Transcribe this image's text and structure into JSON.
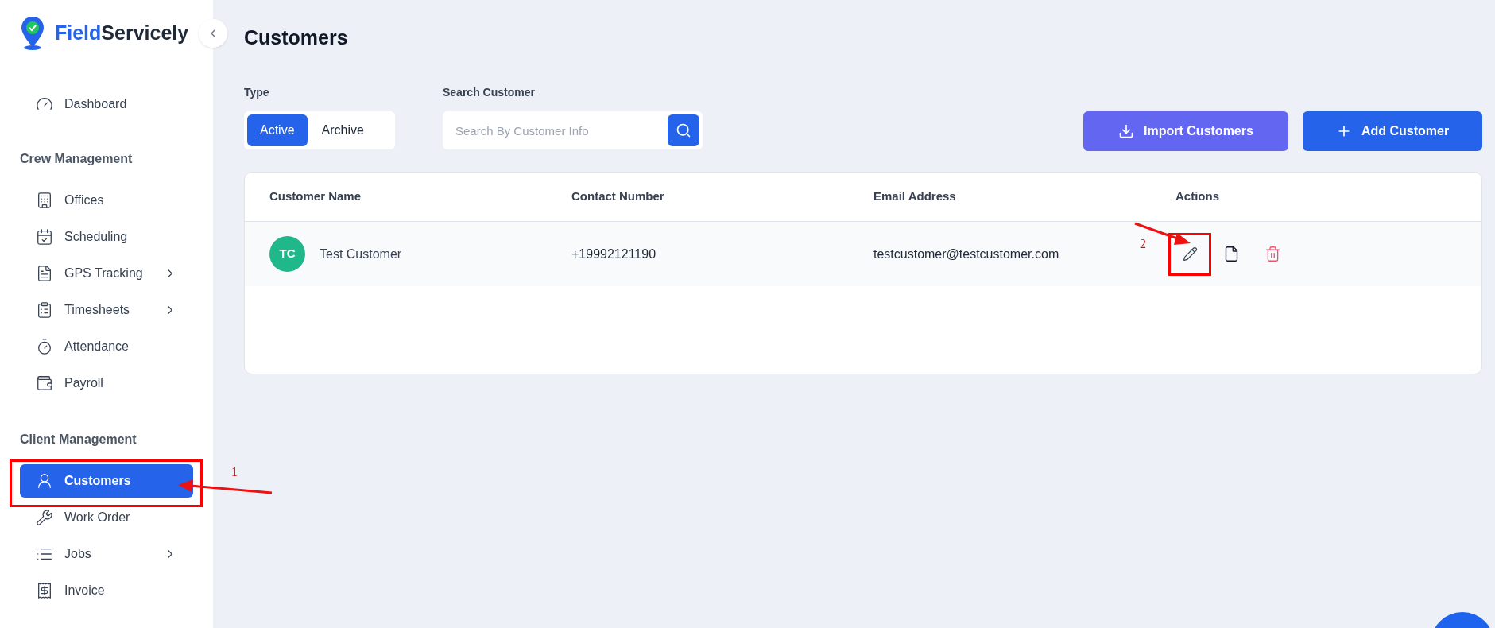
{
  "brand": {
    "first": "Field",
    "second": "Servicely"
  },
  "sidebar": {
    "sections": [
      {
        "items": [
          {
            "label": "Dashboard",
            "selected": false,
            "expandable": false
          }
        ]
      },
      {
        "heading": "Crew Management",
        "items": [
          {
            "label": "Offices",
            "selected": false,
            "expandable": false
          },
          {
            "label": "Scheduling",
            "selected": false,
            "expandable": false
          },
          {
            "label": "GPS Tracking",
            "selected": false,
            "expandable": true
          },
          {
            "label": "Timesheets",
            "selected": false,
            "expandable": true
          },
          {
            "label": "Attendance",
            "selected": false,
            "expandable": false
          },
          {
            "label": "Payroll",
            "selected": false,
            "expandable": false
          }
        ]
      },
      {
        "heading": "Client Management",
        "items": [
          {
            "label": "Customers",
            "selected": true,
            "expandable": false
          },
          {
            "label": "Work Order",
            "selected": false,
            "expandable": false
          },
          {
            "label": "Jobs",
            "selected": false,
            "expandable": true
          },
          {
            "label": "Invoice",
            "selected": false,
            "expandable": false
          }
        ]
      }
    ]
  },
  "page_title": "Customers",
  "type_filter": {
    "label": "Type",
    "options": [
      {
        "label": "Active",
        "selected": true
      },
      {
        "label": "Archive",
        "selected": false
      }
    ]
  },
  "search": {
    "label": "Search Customer",
    "placeholder": "Search By Customer Info"
  },
  "buttons": [
    {
      "label": "Import Customers",
      "kind": "import"
    },
    {
      "label": "Add Customer",
      "kind": "add"
    }
  ],
  "table": {
    "columns": [
      "Customer Name",
      "Contact Number",
      "Email Address",
      "Actions"
    ],
    "rows": [
      {
        "initials": "TC",
        "name": "Test Customer",
        "phone": "+19992121190",
        "email": "testcustomer@testcustomer.com"
      }
    ]
  },
  "annotations": [
    {
      "label": "1"
    },
    {
      "label": "2"
    }
  ]
}
